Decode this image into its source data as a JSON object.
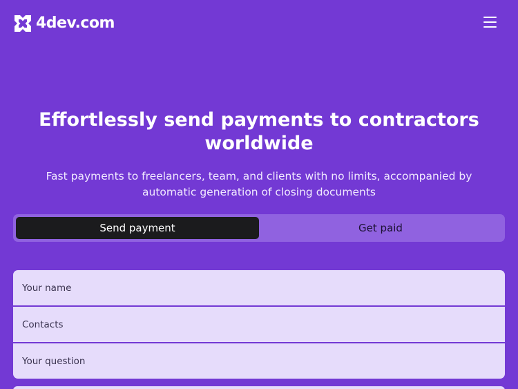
{
  "header": {
    "logo_text": "4dev.com",
    "menu_icon": "hamburger-menu-icon"
  },
  "hero": {
    "title": "Effortlessly send payments to contractors worldwide",
    "subtitle": "Fast payments to freelancers, team, and clients with no limits, accompanied by automatic generation of closing documents"
  },
  "tabs": [
    {
      "label": "Send payment",
      "active": true
    },
    {
      "label": "Get paid",
      "active": false
    }
  ],
  "form": {
    "fields": [
      {
        "placeholder": "Your name",
        "value": ""
      },
      {
        "placeholder": "Contacts",
        "value": ""
      },
      {
        "placeholder": "Your question",
        "value": ""
      }
    ]
  },
  "colors": {
    "background": "#7339d4",
    "tab_track": "#9062e0",
    "tab_active": "#1b1b1d",
    "field_background": "#e6dcfb"
  }
}
